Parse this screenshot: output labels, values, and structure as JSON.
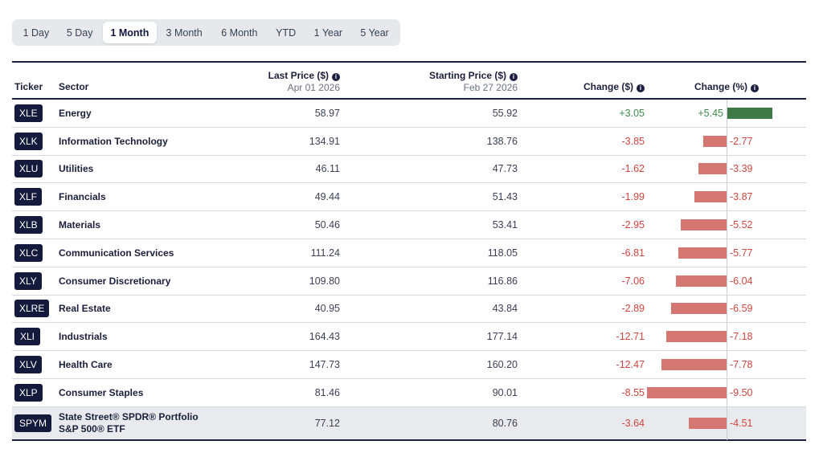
{
  "tabs": [
    {
      "label": "1 Day",
      "active": false
    },
    {
      "label": "5 Day",
      "active": false
    },
    {
      "label": "1 Month",
      "active": true
    },
    {
      "label": "3 Month",
      "active": false
    },
    {
      "label": "6 Month",
      "active": false
    },
    {
      "label": "YTD",
      "active": false
    },
    {
      "label": "1 Year",
      "active": false
    },
    {
      "label": "5 Year",
      "active": false
    }
  ],
  "table": {
    "headers": {
      "ticker": "Ticker",
      "sector": "Sector",
      "last_price": "Last Price ($)",
      "last_price_date": "Apr 01 2026",
      "starting_price": "Starting Price ($)",
      "starting_price_date": "Feb 27 2026",
      "change_usd": "Change ($)",
      "change_pct": "Change (%)"
    },
    "info_icon": "i",
    "rows": [
      {
        "ticker": "XLE",
        "sector": "Energy",
        "last": "58.97",
        "start": "55.92",
        "change": "+3.05",
        "pct_label": "+5.45",
        "pct": 5.45
      },
      {
        "ticker": "XLK",
        "sector": "Information Technology",
        "last": "134.91",
        "start": "138.76",
        "change": "-3.85",
        "pct_label": "-2.77",
        "pct": -2.77
      },
      {
        "ticker": "XLU",
        "sector": "Utilities",
        "last": "46.11",
        "start": "47.73",
        "change": "-1.62",
        "pct_label": "-3.39",
        "pct": -3.39
      },
      {
        "ticker": "XLF",
        "sector": "Financials",
        "last": "49.44",
        "start": "51.43",
        "change": "-1.99",
        "pct_label": "-3.87",
        "pct": -3.87
      },
      {
        "ticker": "XLB",
        "sector": "Materials",
        "last": "50.46",
        "start": "53.41",
        "change": "-2.95",
        "pct_label": "-5.52",
        "pct": -5.52
      },
      {
        "ticker": "XLC",
        "sector": "Communication Services",
        "last": "111.24",
        "start": "118.05",
        "change": "-6.81",
        "pct_label": "-5.77",
        "pct": -5.77
      },
      {
        "ticker": "XLY",
        "sector": "Consumer Discretionary",
        "last": "109.80",
        "start": "116.86",
        "change": "-7.06",
        "pct_label": "-6.04",
        "pct": -6.04
      },
      {
        "ticker": "XLRE",
        "sector": "Real Estate",
        "last": "40.95",
        "start": "43.84",
        "change": "-2.89",
        "pct_label": "-6.59",
        "pct": -6.59
      },
      {
        "ticker": "XLI",
        "sector": "Industrials",
        "last": "164.43",
        "start": "177.14",
        "change": "-12.71",
        "pct_label": "-7.18",
        "pct": -7.18
      },
      {
        "ticker": "XLV",
        "sector": "Health Care",
        "last": "147.73",
        "start": "160.20",
        "change": "-12.47",
        "pct_label": "-7.78",
        "pct": -7.78
      },
      {
        "ticker": "XLP",
        "sector": "Consumer Staples",
        "last": "81.46",
        "start": "90.01",
        "change": "-8.55",
        "pct_label": "-9.50",
        "pct": -9.5
      }
    ],
    "benchmark": {
      "ticker": "SPYM",
      "sector": "State Street® SPDR® Portfolio S&P 500® ETF",
      "last": "77.12",
      "start": "80.76",
      "change": "-3.64",
      "pct_label": "-4.51",
      "pct": -4.51
    }
  },
  "colors": {
    "positive": "#3d8a4a",
    "negative": "#d0453f",
    "positive_bar": "#3f7a46",
    "negative_bar": "#d47772",
    "ticker_bg": "#141a3c"
  }
}
